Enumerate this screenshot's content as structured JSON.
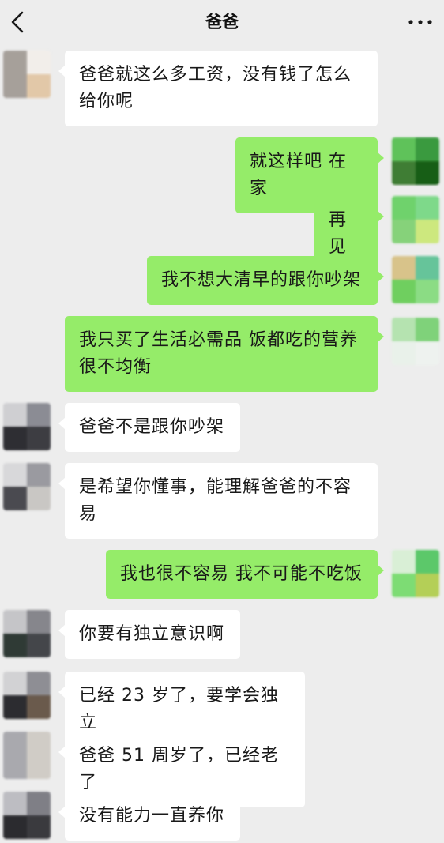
{
  "header": {
    "title": "爸爸",
    "back_icon": "chevron-left-icon",
    "more_icon": "more-dots-icon"
  },
  "colors": {
    "background": "#ededed",
    "incoming_bubble": "#ffffff",
    "outgoing_bubble": "#95ec69",
    "text": "#191919"
  },
  "messages": [
    {
      "side": "left",
      "text": "爸爸就这么多工资，没有钱了怎么给你呢"
    },
    {
      "side": "right",
      "text": "就这样吧 在家"
    },
    {
      "side": "right",
      "text": "再见"
    },
    {
      "side": "right",
      "text": "我不想大清早的跟你吵架"
    },
    {
      "side": "right",
      "text": "我只买了生活必需品 饭都吃的营养很不均衡"
    },
    {
      "side": "left",
      "text": "爸爸不是跟你吵架"
    },
    {
      "side": "left",
      "text": "是希望你懂事，能理解爸爸的不容易"
    },
    {
      "side": "right",
      "text": "我也很不容易 我不可能不吃饭"
    },
    {
      "side": "left",
      "text": "你要有独立意识啊"
    },
    {
      "side": "left",
      "text": "已经 23 岁了，要学会独立"
    },
    {
      "side": "left",
      "text": "爸爸 51 周岁了，已经老了"
    },
    {
      "side": "left",
      "text": "没有能力一直养你"
    }
  ]
}
